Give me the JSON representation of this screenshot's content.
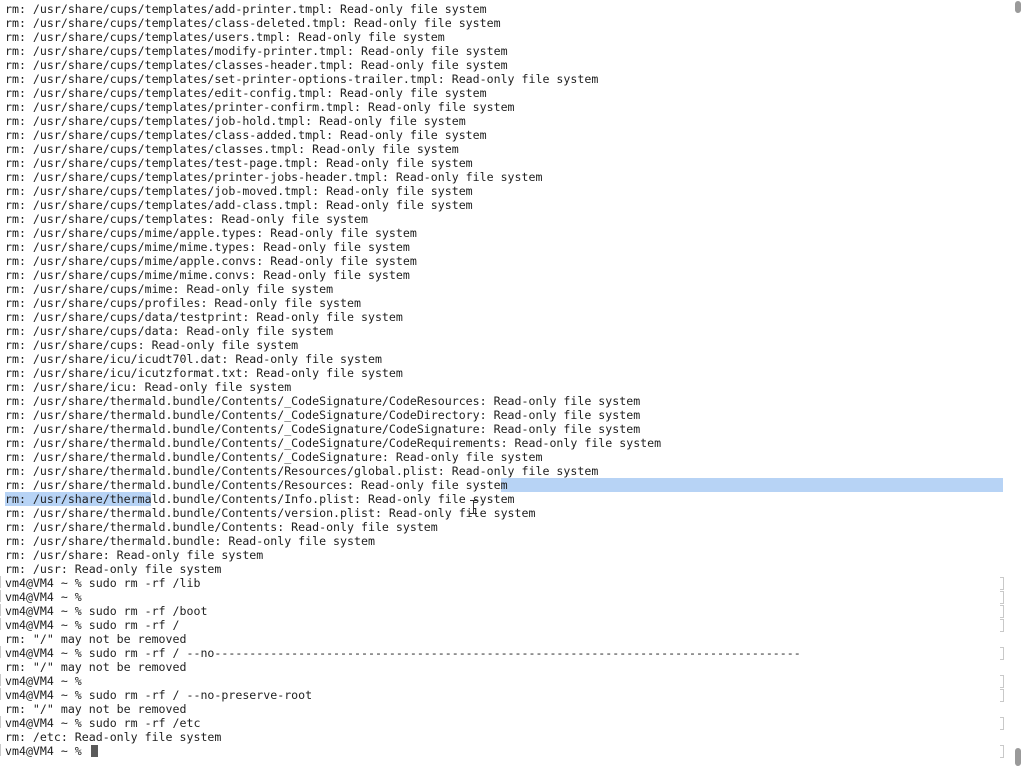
{
  "terminal": {
    "selection": {
      "color": "#b7d3f5"
    },
    "lines": [
      "rm: /usr/share/cups/templates/add-printer.tmpl: Read-only file system",
      "rm: /usr/share/cups/templates/class-deleted.tmpl: Read-only file system",
      "rm: /usr/share/cups/templates/users.tmpl: Read-only file system",
      "rm: /usr/share/cups/templates/modify-printer.tmpl: Read-only file system",
      "rm: /usr/share/cups/templates/classes-header.tmpl: Read-only file system",
      "rm: /usr/share/cups/templates/set-printer-options-trailer.tmpl: Read-only file system",
      "rm: /usr/share/cups/templates/edit-config.tmpl: Read-only file system",
      "rm: /usr/share/cups/templates/printer-confirm.tmpl: Read-only file system",
      "rm: /usr/share/cups/templates/job-hold.tmpl: Read-only file system",
      "rm: /usr/share/cups/templates/class-added.tmpl: Read-only file system",
      "rm: /usr/share/cups/templates/classes.tmpl: Read-only file system",
      "rm: /usr/share/cups/templates/test-page.tmpl: Read-only file system",
      "rm: /usr/share/cups/templates/printer-jobs-header.tmpl: Read-only file system",
      "rm: /usr/share/cups/templates/job-moved.tmpl: Read-only file system",
      "rm: /usr/share/cups/templates/add-class.tmpl: Read-only file system",
      "rm: /usr/share/cups/templates: Read-only file system",
      "rm: /usr/share/cups/mime/apple.types: Read-only file system",
      "rm: /usr/share/cups/mime/mime.types: Read-only file system",
      "rm: /usr/share/cups/mime/apple.convs: Read-only file system",
      "rm: /usr/share/cups/mime/mime.convs: Read-only file system",
      "rm: /usr/share/cups/mime: Read-only file system",
      "rm: /usr/share/cups/profiles: Read-only file system",
      "rm: /usr/share/cups/data/testprint: Read-only file system",
      "rm: /usr/share/cups/data: Read-only file system",
      "rm: /usr/share/cups: Read-only file system",
      "rm: /usr/share/icu/icudt70l.dat: Read-only file system",
      "rm: /usr/share/icu/icutzformat.txt: Read-only file system",
      "rm: /usr/share/icu: Read-only file system",
      "rm: /usr/share/thermald.bundle/Contents/_CodeSignature/CodeResources: Read-only file system",
      "rm: /usr/share/thermald.bundle/Contents/_CodeSignature/CodeDirectory: Read-only file system",
      "rm: /usr/share/thermald.bundle/Contents/_CodeSignature/CodeSignature: Read-only file system",
      "rm: /usr/share/thermald.bundle/Contents/_CodeSignature/CodeRequirements: Read-only file system",
      "rm: /usr/share/thermald.bundle/Contents/_CodeSignature: Read-only file system",
      "rm: /usr/share/thermald.bundle/Contents/Resources/global.plist: Read-only file system",
      "rm: /usr/share/thermald.bundle/Contents/Resources: Read-only file system",
      "rm: /usr/share/thermald.bundle/Contents/Info.plist: Read-only file system",
      "rm: /usr/share/thermald.bundle/Contents/version.plist: Read-only file system",
      "rm: /usr/share/thermald.bundle/Contents: Read-only file system",
      "rm: /usr/share/thermald.bundle: Read-only file system",
      "rm: /usr/share: Read-only file system",
      "rm: /usr: Read-only file system",
      "vm4@VM4 ~ % sudo rm -rf /lib",
      "vm4@VM4 ~ %",
      "vm4@VM4 ~ % sudo rm -rf /boot",
      "vm4@VM4 ~ % sudo rm -rf /",
      "rm: \"/\" may not be removed",
      "vm4@VM4 ~ % sudo rm -rf / --no------------------------------------------------------------------------------------",
      "rm: \"/\" may not be removed",
      "vm4@VM4 ~ %",
      "vm4@VM4 ~ % sudo rm -rf / --no-preserve-root",
      "rm: \"/\" may not be removed",
      "vm4@VM4 ~ % sudo rm -rf /etc",
      "rm: /etc: Read-only file system",
      "vm4@VM4 ~ % "
    ]
  }
}
